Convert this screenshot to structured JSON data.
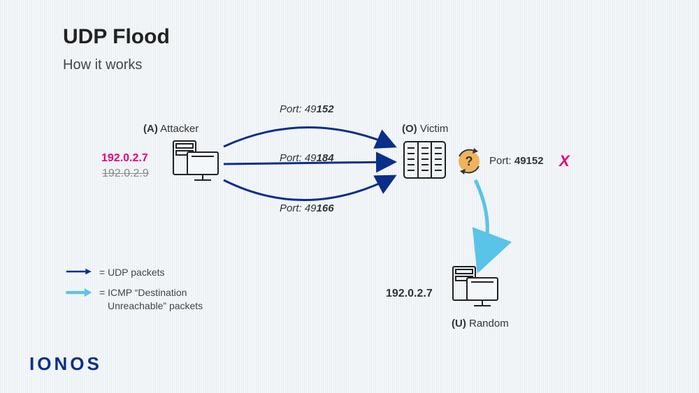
{
  "title": "UDP Flood",
  "subtitle": "How it works",
  "attacker": {
    "label_prefix": "(A)",
    "label": "Attacker",
    "ip_spoofed": "192.0.2.7",
    "ip_real": "192.0.2.9"
  },
  "victim": {
    "label_prefix": "(O)",
    "label": "Victim"
  },
  "random": {
    "label_prefix": "(U)",
    "label": "Random",
    "ip": "192.0.2.7"
  },
  "ports": {
    "p1_prefix": "Port: 49",
    "p1_bold": "152",
    "p2_prefix": "Port: 49",
    "p2_bold": "184",
    "p3_prefix": "Port: 49",
    "p3_bold": "166"
  },
  "check": {
    "port_prefix": "Port: ",
    "port_bold": "49152",
    "x": "X"
  },
  "legend": {
    "udp": "= UDP packets",
    "icmp_l1": "= ICMP “Destination",
    "icmp_l2": "Unreachable” packets"
  },
  "logo": "IONOS",
  "colors": {
    "navy": "#0b2e8a",
    "cyan": "#5ac3e8",
    "pink": "#e6007e",
    "orange": "#f0b35a"
  }
}
